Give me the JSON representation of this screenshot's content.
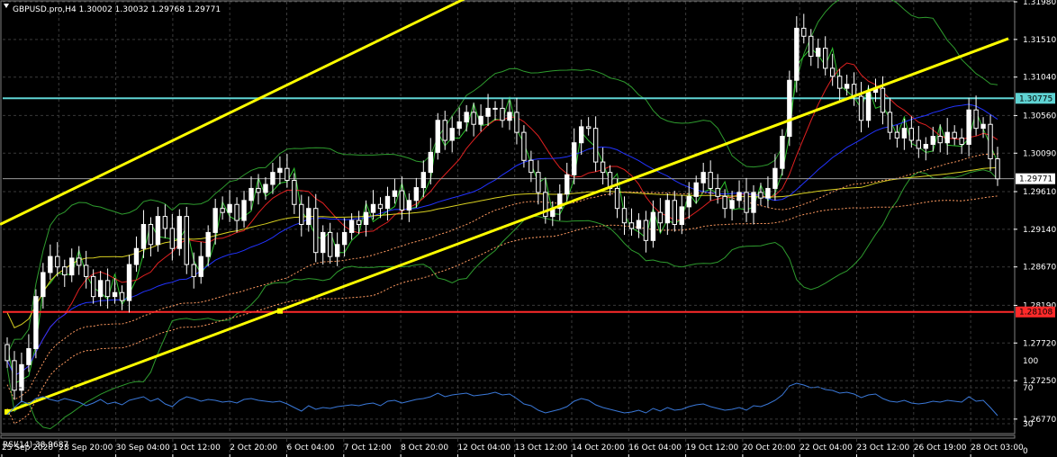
{
  "header": {
    "symbol_info": "GBPUSD.pro,H4  1.30002 1.30032 1.29768 1.29771",
    "rsi_info": "RSI(14) 38.9687"
  },
  "colors": {
    "background": "#000000",
    "grid": "#3a3a3a",
    "bull_candle": "#ffffff",
    "bear_candle": "#000000",
    "trendline": "#ffff00",
    "resistance": "#5fd3d3",
    "support": "#ff2a2a",
    "bollinger": "#2e9b2e",
    "rsi": "#3a78d8"
  },
  "chart_data": [
    {
      "type": "candlestick",
      "title": "GBPUSD.pro,H4",
      "last_ohlc": {
        "open": 1.30002,
        "high": 1.30032,
        "low": 1.29768,
        "close": 1.29771
      },
      "ylim": [
        1.266,
        1.3198
      ],
      "yticks": [
        "1.31980",
        "1.31510",
        "1.31040",
        "1.30560",
        "1.30090",
        "1.29610",
        "1.29140",
        "1.28670",
        "1.28190",
        "1.27720",
        "1.27250",
        "1.26770"
      ],
      "xticks": [
        "25 Sep 2020",
        "28 Sep 20:00",
        "30 Sep 04:00",
        "1 Oct 12:00",
        "2 Oct 20:00",
        "6 Oct 04:00",
        "7 Oct 12:00",
        "8 Oct 20:00",
        "12 Oct 04:00",
        "13 Oct 12:00",
        "14 Oct 20:00",
        "16 Oct 04:00",
        "19 Oct 12:00",
        "20 Oct 20:00",
        "22 Oct 04:00",
        "23 Oct 12:00",
        "26 Oct 19:00",
        "28 Oct 03:00"
      ],
      "price_tags": [
        {
          "label": "1.30775",
          "value": 1.30775,
          "kind": "resistance"
        },
        {
          "label": "1.29771",
          "value": 1.29771,
          "kind": "current"
        },
        {
          "label": "1.28108",
          "value": 1.28108,
          "kind": "support"
        }
      ],
      "close": [
        1.275,
        1.2713,
        1.2745,
        1.2765,
        1.283,
        1.286,
        1.288,
        1.2867,
        1.2857,
        1.2878,
        1.2869,
        1.2855,
        1.283,
        1.285,
        1.283,
        1.2835,
        1.2825,
        1.287,
        1.289,
        1.292,
        1.2895,
        1.293,
        1.2915,
        1.289,
        1.293,
        1.287,
        1.2855,
        1.288,
        1.291,
        1.294,
        1.2935,
        1.2945,
        1.2925,
        1.295,
        1.2965,
        1.296,
        1.297,
        1.2985,
        1.299,
        1.2975,
        1.2945,
        1.292,
        1.294,
        1.2885,
        1.291,
        1.288,
        1.2895,
        1.291,
        1.2925,
        1.292,
        1.2935,
        1.2945,
        1.294,
        1.2955,
        1.2962,
        1.2938,
        1.295,
        1.2966,
        1.2985,
        1.301,
        1.305,
        1.3025,
        1.304,
        1.3048,
        1.306,
        1.3045,
        1.3055,
        1.3065,
        1.3065,
        1.305,
        1.306,
        1.3035,
        1.3,
        1.2985,
        1.296,
        1.293,
        1.294,
        1.2958,
        1.2982,
        1.3022,
        1.3042,
        1.304,
        1.2998,
        1.2985,
        1.2965,
        1.294,
        1.2922,
        1.2915,
        1.2925,
        1.29,
        1.2935,
        1.2922,
        1.295,
        1.292,
        1.2942,
        1.2955,
        1.2972,
        1.2985,
        1.2965,
        1.2955,
        1.294,
        1.295,
        1.296,
        1.2935,
        1.296,
        1.2953,
        1.2965,
        1.299,
        1.303,
        1.31,
        1.3165,
        1.3155,
        1.313,
        1.314,
        1.3115,
        1.3105,
        1.309,
        1.3095,
        1.308,
        1.305,
        1.3085,
        1.309,
        1.306,
        1.3035,
        1.3028,
        1.304,
        1.3025,
        1.3015,
        1.302,
        1.303,
        1.3022,
        1.3035,
        1.3028,
        1.302,
        1.3063,
        1.304,
        1.3045,
        1.3002,
        1.2977
      ],
      "rsi": [
        40,
        48,
        55,
        52,
        58,
        60,
        57,
        55,
        58,
        56,
        54,
        50,
        53,
        57,
        52,
        54,
        51,
        56,
        58,
        60,
        55,
        58,
        52,
        49,
        56,
        60,
        58,
        55,
        57,
        56,
        54,
        55,
        53,
        57,
        58,
        56,
        55,
        54,
        55,
        52,
        48,
        44,
        50,
        46,
        48,
        47,
        49,
        50,
        51,
        50,
        52,
        53,
        50,
        55,
        56,
        53,
        55,
        57,
        58,
        60,
        64,
        60,
        62,
        63,
        64,
        61,
        62,
        63,
        65,
        62,
        63,
        58,
        52,
        50,
        45,
        42,
        44,
        46,
        49,
        55,
        58,
        56,
        51,
        48,
        46,
        44,
        42,
        43,
        45,
        42,
        47,
        44,
        48,
        45,
        46,
        49,
        51,
        52,
        49,
        47,
        45,
        46,
        48,
        45,
        50,
        49,
        52,
        56,
        62,
        72,
        75,
        73,
        70,
        71,
        68,
        67,
        64,
        65,
        63,
        59,
        62,
        63,
        58,
        55,
        54,
        56,
        53,
        52,
        53,
        55,
        54,
        56,
        55,
        54,
        60,
        55,
        56,
        48,
        39
      ],
      "rsi_ylim": [
        0,
        100
      ],
      "rsi_ticks": [
        "100",
        "70",
        "30",
        "0"
      ],
      "rsi_levels": [
        70,
        30
      ]
    }
  ]
}
